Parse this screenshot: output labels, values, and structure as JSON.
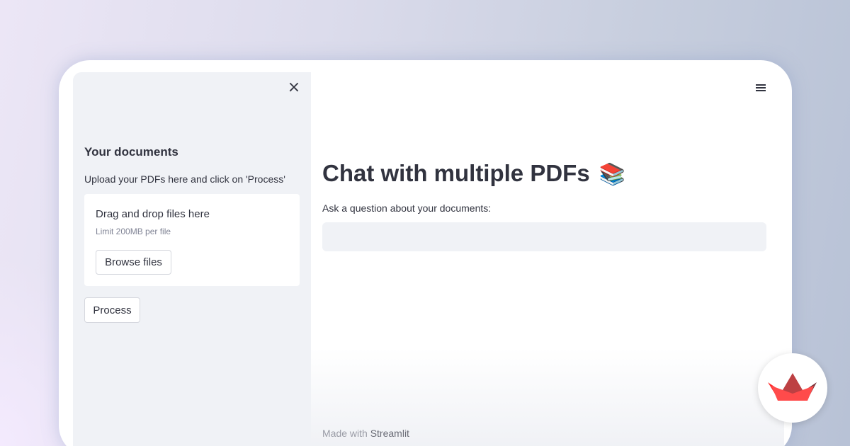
{
  "sidebar": {
    "close_icon": "×",
    "title": "Your documents",
    "subtitle": "Upload your PDFs here and click on 'Process'",
    "uploader": {
      "title": "Drag and drop files here",
      "limit": "Limit 200MB per file",
      "browse_label": "Browse files"
    },
    "process_label": "Process"
  },
  "main": {
    "menu_icon": "hamburger-menu-icon",
    "title": "Chat with multiple PDFs",
    "title_emoji": "📚",
    "question_label": "Ask a question about your documents:",
    "question_value": "",
    "footer_prefix": "Made with",
    "footer_link": "Streamlit"
  },
  "colors": {
    "text": "#31333f",
    "sidebar_bg": "#f0f2f6",
    "input_bg": "#f0f2f6",
    "brand_red": "#ff4b4b",
    "brand_dark_red": "#7d353b"
  }
}
